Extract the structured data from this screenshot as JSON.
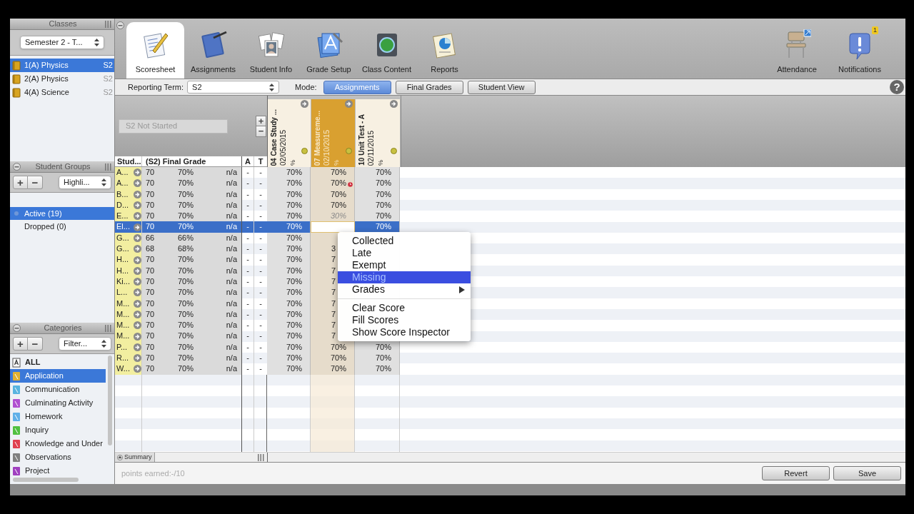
{
  "sidebar": {
    "classes": {
      "title": "Classes",
      "term_popup": "Semester 2 - T...",
      "items": [
        {
          "name": "1(A) Physics",
          "term": "S2",
          "selected": true
        },
        {
          "name": "2(A) Physics",
          "term": "S2",
          "selected": false
        },
        {
          "name": "4(A) Science",
          "term": "S2",
          "selected": false
        }
      ]
    },
    "student_groups": {
      "title": "Student Groups",
      "add": "+",
      "remove": "−",
      "popup": "Highli...",
      "items": [
        {
          "label": "Active (19)",
          "selected": true
        },
        {
          "label": "Dropped (0)",
          "selected": false
        }
      ]
    },
    "categories": {
      "title": "Categories",
      "add": "+",
      "remove": "−",
      "popup": "Filter...",
      "items": [
        {
          "label": "ALL",
          "kind": "all",
          "selected": false
        },
        {
          "label": "Application",
          "kind": "category",
          "color": "#e0b030",
          "selected": true
        },
        {
          "label": "Communication",
          "kind": "category",
          "color": "#58b4e0",
          "selected": false
        },
        {
          "label": "Culminating Activity",
          "kind": "category",
          "color": "#b050d0",
          "selected": false
        },
        {
          "label": "Homework",
          "kind": "category",
          "color": "#60b0e8",
          "selected": false
        },
        {
          "label": "Inquiry",
          "kind": "category",
          "color": "#50c040",
          "selected": false
        },
        {
          "label": "Knowledge and Under",
          "kind": "category",
          "color": "#e04050",
          "selected": false
        },
        {
          "label": "Observations",
          "kind": "category",
          "color": "#808080",
          "selected": false
        },
        {
          "label": "Project",
          "kind": "category",
          "color": "#a040c0",
          "selected": false
        }
      ]
    }
  },
  "toolbar": {
    "tabs": [
      {
        "label": "Scoresheet",
        "kind": "scoresheet",
        "selected": true
      },
      {
        "label": "Assignments",
        "kind": "assignments",
        "selected": false
      },
      {
        "label": "Student Info",
        "kind": "student_info",
        "selected": false
      },
      {
        "label": "Grade Setup",
        "kind": "grade_setup",
        "selected": false
      },
      {
        "label": "Class Content",
        "kind": "class_content",
        "selected": false
      },
      {
        "label": "Reports",
        "kind": "reports",
        "selected": false
      }
    ],
    "right": [
      {
        "label": "Attendance",
        "kind": "attendance"
      },
      {
        "label": "Notifications",
        "kind": "notifications",
        "badge": "1"
      }
    ]
  },
  "mode_bar": {
    "reporting_term_label": "Reporting Term:",
    "reporting_term": "S2",
    "mode_label": "Mode:",
    "modes": [
      {
        "label": "Assignments",
        "selected": true
      },
      {
        "label": "Final Grades",
        "selected": false
      },
      {
        "label": "Student View",
        "selected": false
      }
    ],
    "help": "?"
  },
  "scoresheet": {
    "status_field": "S2 Not Started",
    "add": "+",
    "remove": "−",
    "columns": [
      "Stud...",
      "(S2) Final Grade",
      "A",
      "T"
    ],
    "assignments": [
      {
        "title": "04 Case Study ...",
        "date": "02/05/2015",
        "unit": "%",
        "selected": false
      },
      {
        "title": "07 Measureme...",
        "date": "02/10/2015",
        "unit": "%",
        "selected": true
      },
      {
        "title": "10 Unit Test - A",
        "date": "02/11/2015",
        "unit": "%",
        "selected": false
      }
    ],
    "rows": [
      {
        "student": "A...",
        "score": "70",
        "percent": "70%",
        "letter": "n/a",
        "a": "-",
        "t": "-",
        "selected": false,
        "scores": [
          {
            "kind": "normal",
            "text": "70%"
          },
          {
            "kind": "normal",
            "text": "70%"
          },
          {
            "kind": "normal",
            "text": "70%"
          }
        ]
      },
      {
        "student": "A...",
        "score": "70",
        "percent": "70%",
        "letter": "n/a",
        "a": "-",
        "t": "-",
        "selected": false,
        "scores": [
          {
            "kind": "normal",
            "text": "70%"
          },
          {
            "kind": "late",
            "text": "70%"
          },
          {
            "kind": "normal",
            "text": "70%"
          }
        ]
      },
      {
        "student": "B...",
        "score": "70",
        "percent": "70%",
        "letter": "n/a",
        "a": "-",
        "t": "-",
        "selected": false,
        "scores": [
          {
            "kind": "normal",
            "text": "70%"
          },
          {
            "kind": "normal",
            "text": "70%"
          },
          {
            "kind": "normal",
            "text": "70%"
          }
        ]
      },
      {
        "student": "D...",
        "score": "70",
        "percent": "70%",
        "letter": "n/a",
        "a": "-",
        "t": "-",
        "selected": false,
        "scores": [
          {
            "kind": "normal",
            "text": "70%"
          },
          {
            "kind": "normal",
            "text": "70%"
          },
          {
            "kind": "normal",
            "text": "70%"
          }
        ]
      },
      {
        "student": "E...",
        "score": "70",
        "percent": "70%",
        "letter": "n/a",
        "a": "-",
        "t": "-",
        "selected": false,
        "scores": [
          {
            "kind": "normal",
            "text": "70%"
          },
          {
            "kind": "dimmed",
            "text": "30%"
          },
          {
            "kind": "normal",
            "text": "70%"
          }
        ]
      },
      {
        "student": "El...",
        "score": "70",
        "percent": "70%",
        "letter": "n/a",
        "a": "-",
        "t": "-",
        "selected": true,
        "scores": [
          {
            "kind": "normal",
            "text": "70%"
          },
          {
            "kind": "editing"
          },
          {
            "kind": "normal",
            "text": "70%"
          }
        ]
      },
      {
        "student": "G...",
        "score": "66",
        "percent": "66%",
        "letter": "n/a",
        "a": "-",
        "t": "-",
        "selected": false,
        "scores": [
          {
            "kind": "normal",
            "text": "70%"
          },
          {
            "kind": "blank"
          },
          {
            "kind": "covered"
          }
        ]
      },
      {
        "student": "G...",
        "score": "68",
        "percent": "68%",
        "letter": "n/a",
        "a": "-",
        "t": "-",
        "selected": false,
        "scores": [
          {
            "kind": "normal",
            "text": "70%"
          },
          {
            "kind": "partial",
            "text": "3"
          },
          {
            "kind": "covered"
          }
        ]
      },
      {
        "student": "H...",
        "score": "70",
        "percent": "70%",
        "letter": "n/a",
        "a": "-",
        "t": "-",
        "selected": false,
        "scores": [
          {
            "kind": "normal",
            "text": "70%"
          },
          {
            "kind": "partial",
            "text": "7"
          },
          {
            "kind": "covered"
          }
        ]
      },
      {
        "student": "H...",
        "score": "70",
        "percent": "70%",
        "letter": "n/a",
        "a": "-",
        "t": "-",
        "selected": false,
        "scores": [
          {
            "kind": "normal",
            "text": "70%"
          },
          {
            "kind": "partial",
            "text": "7"
          },
          {
            "kind": "covered"
          }
        ]
      },
      {
        "student": "Ki...",
        "score": "70",
        "percent": "70%",
        "letter": "n/a",
        "a": "-",
        "t": "-",
        "selected": false,
        "scores": [
          {
            "kind": "normal",
            "text": "70%"
          },
          {
            "kind": "partial",
            "text": "7"
          },
          {
            "kind": "covered"
          }
        ]
      },
      {
        "student": "L...",
        "score": "70",
        "percent": "70%",
        "letter": "n/a",
        "a": "-",
        "t": "-",
        "selected": false,
        "scores": [
          {
            "kind": "normal",
            "text": "70%"
          },
          {
            "kind": "partial",
            "text": "7"
          },
          {
            "kind": "covered"
          }
        ]
      },
      {
        "student": "M...",
        "score": "70",
        "percent": "70%",
        "letter": "n/a",
        "a": "-",
        "t": "-",
        "selected": false,
        "scores": [
          {
            "kind": "normal",
            "text": "70%"
          },
          {
            "kind": "partial",
            "text": "7"
          },
          {
            "kind": "covered"
          }
        ]
      },
      {
        "student": "M...",
        "score": "70",
        "percent": "70%",
        "letter": "n/a",
        "a": "-",
        "t": "-",
        "selected": false,
        "scores": [
          {
            "kind": "normal",
            "text": "70%"
          },
          {
            "kind": "partial",
            "text": "7"
          },
          {
            "kind": "covered"
          }
        ]
      },
      {
        "student": "M...",
        "score": "70",
        "percent": "70%",
        "letter": "n/a",
        "a": "-",
        "t": "-",
        "selected": false,
        "scores": [
          {
            "kind": "normal",
            "text": "70%"
          },
          {
            "kind": "partial",
            "text": "7"
          },
          {
            "kind": "covered"
          }
        ]
      },
      {
        "student": "M...",
        "score": "70",
        "percent": "70%",
        "letter": "n/a",
        "a": "-",
        "t": "-",
        "selected": false,
        "scores": [
          {
            "kind": "normal",
            "text": "70%"
          },
          {
            "kind": "partial",
            "text": "7"
          },
          {
            "kind": "covered"
          }
        ]
      },
      {
        "student": "P...",
        "score": "70",
        "percent": "70%",
        "letter": "n/a",
        "a": "-",
        "t": "-",
        "selected": false,
        "scores": [
          {
            "kind": "normal",
            "text": "70%"
          },
          {
            "kind": "normal",
            "text": "70%"
          },
          {
            "kind": "normal",
            "text": "70%"
          }
        ]
      },
      {
        "student": "R...",
        "score": "70",
        "percent": "70%",
        "letter": "n/a",
        "a": "-",
        "t": "-",
        "selected": false,
        "scores": [
          {
            "kind": "normal",
            "text": "70%"
          },
          {
            "kind": "normal",
            "text": "70%"
          },
          {
            "kind": "normal",
            "text": "70%"
          }
        ]
      },
      {
        "student": "W...",
        "score": "70",
        "percent": "70%",
        "letter": "n/a",
        "a": "-",
        "t": "-",
        "selected": false,
        "scores": [
          {
            "kind": "normal",
            "text": "70%"
          },
          {
            "kind": "normal",
            "text": "70%"
          },
          {
            "kind": "normal",
            "text": "70%"
          }
        ]
      }
    ],
    "summary_tab": "Summary"
  },
  "status_bar": {
    "text": "points earned:-/10",
    "buttons": [
      "Revert",
      "Save"
    ]
  },
  "context_menu": {
    "sections": [
      [
        {
          "label": "Collected",
          "kind": "action",
          "selected": false
        },
        {
          "label": "Late",
          "kind": "action",
          "selected": false
        },
        {
          "label": "Exempt",
          "kind": "action",
          "selected": false
        },
        {
          "label": "Missing",
          "kind": "action",
          "selected": true
        },
        {
          "label": "Grades",
          "kind": "submenu",
          "selected": false
        }
      ],
      [
        {
          "label": "Clear Score",
          "kind": "action",
          "selected": false
        },
        {
          "label": "Fill Scores",
          "kind": "action",
          "selected": false
        },
        {
          "label": "Show Score Inspector",
          "kind": "action",
          "selected": false
        }
      ]
    ]
  }
}
